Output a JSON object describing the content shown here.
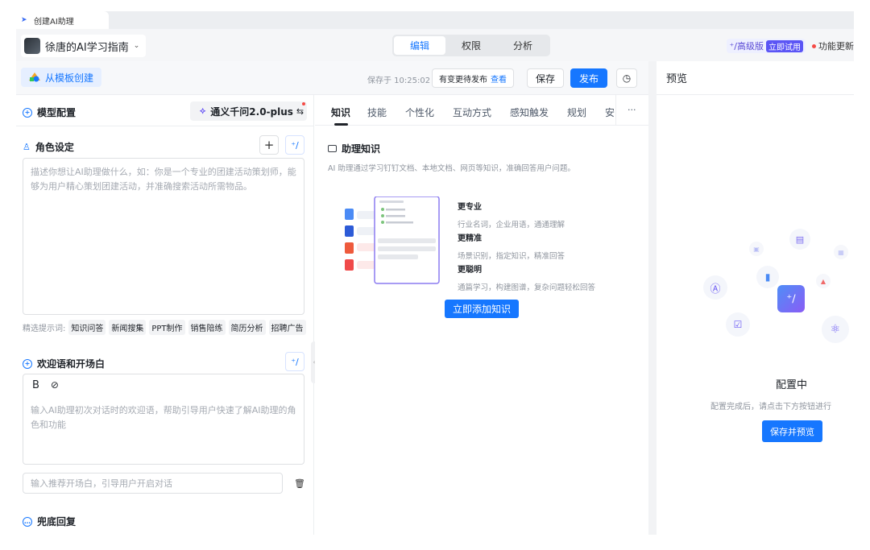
{
  "browser_tab": {
    "title": "创建AI助理"
  },
  "header": {
    "agent_name": "徐唐的AI学习指南",
    "mode_tabs": [
      {
        "label": "编辑",
        "active": true
      },
      {
        "label": "权限"
      },
      {
        "label": "分析"
      }
    ],
    "pro_label": "高级版",
    "pro_trial": "立即试用",
    "update_label": "功能更新"
  },
  "toolbar": {
    "template_button": "从模板创建",
    "saved_text": "保存于 10:25:02",
    "pending_text": "有变更待发布",
    "pending_link": "查看",
    "save_label": "保存",
    "publish_label": "发布"
  },
  "config": {
    "model_section": "模型配置",
    "model_name": "通义千问2.0-plus",
    "role_section": "角色设定",
    "role_placeholder": "描述你想让AI助理做什么，如：你是一个专业的团建活动策划师，能够为用户精心策划团建活动，并准确搜索活动所需物品。",
    "examples_label": "精选提示词:",
    "examples": [
      "知识问答",
      "新闻搜集",
      "PPT制作",
      "销售陪练",
      "简历分析",
      "招聘广告"
    ],
    "welcome_section": "欢迎语和开场白",
    "welcome_placeholder": "输入AI助理初次对话时的欢迎语，帮助引导用户快速了解AI助理的角色和功能",
    "opener_placeholder": "输入推荐开场白，引导用户开启对话",
    "fallback_section": "兜底回复"
  },
  "knowledge": {
    "tabs": [
      "知识",
      "技能",
      "个性化",
      "互动方式",
      "感知触发",
      "规划",
      "安"
    ],
    "title": "助理知识",
    "description": "AI 助理通过学习钉钉文档、本地文档、网页等知识，准确回答用户问题。",
    "features": [
      {
        "title": "更专业",
        "desc": "行业名词，企业用语，通通理解"
      },
      {
        "title": "更精准",
        "desc": "场景识别，指定知识，精准回答"
      },
      {
        "title": "更聪明",
        "desc": "通篇学习，构建图谱，复杂问题轻松回答"
      }
    ],
    "add_button": "立即添加知识"
  },
  "preview": {
    "title": "预览",
    "status": "配置中",
    "hint": "配置完成后，请点击下方按钮进行",
    "button": "保存并预览"
  },
  "colors": {
    "accent": "#1677ff",
    "pro": "#5b55f5",
    "bg": "#f2f3f5"
  }
}
